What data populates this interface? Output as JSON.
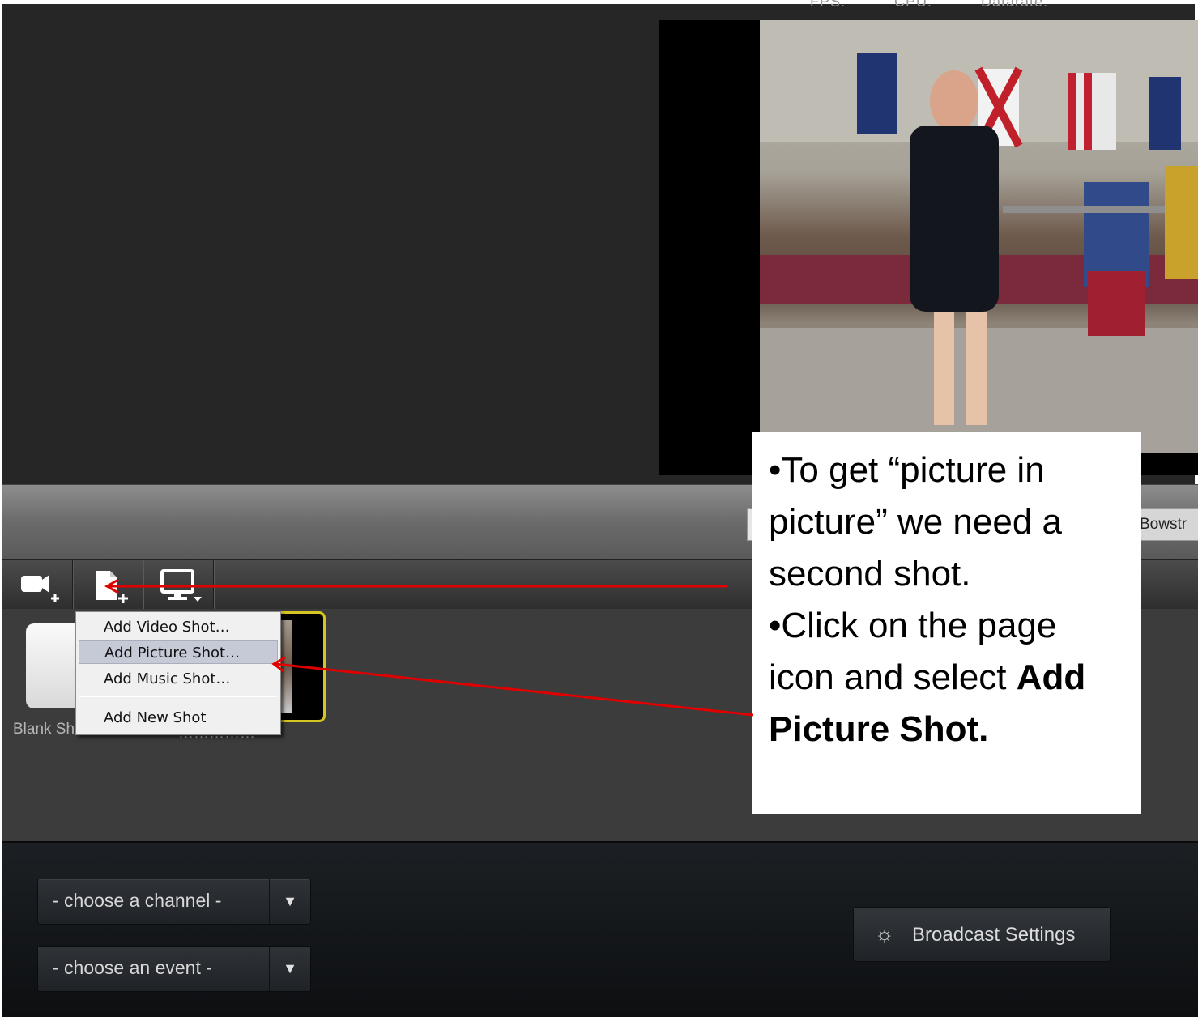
{
  "top_stats": [
    "FPS:",
    "CPU:",
    "Datarate:"
  ],
  "tab_partial": "Bowstr",
  "toolbar": {
    "video_icon": "video-camera-plus-icon",
    "page_icon": "page-plus-icon",
    "monitor_icon": "monitor-dropdown-icon"
  },
  "shots": {
    "blank_label": "Blank Sh",
    "video_label": "……………"
  },
  "context_menu": {
    "items": [
      "Add Video Shot…",
      "Add Picture Shot…",
      "Add Music Shot…",
      "Add New Shot"
    ],
    "selected": "Add Picture Shot…"
  },
  "bottom": {
    "channel_select": "- choose a channel -",
    "event_select": "- choose an event -",
    "broadcast_button": "Broadcast Settings"
  },
  "callout": {
    "line1": "•To get “picture in",
    "line2": "picture” we need a",
    "line3": "second shot.",
    "line4": "•Click on the page",
    "line5a": "icon and select ",
    "line5b": "Add",
    "line6": "Picture Shot."
  },
  "colors": {
    "annotation_arrow": "#e00000",
    "selected_thumb_border": "#d6c520",
    "menu_highlight": "#c5cad6"
  }
}
